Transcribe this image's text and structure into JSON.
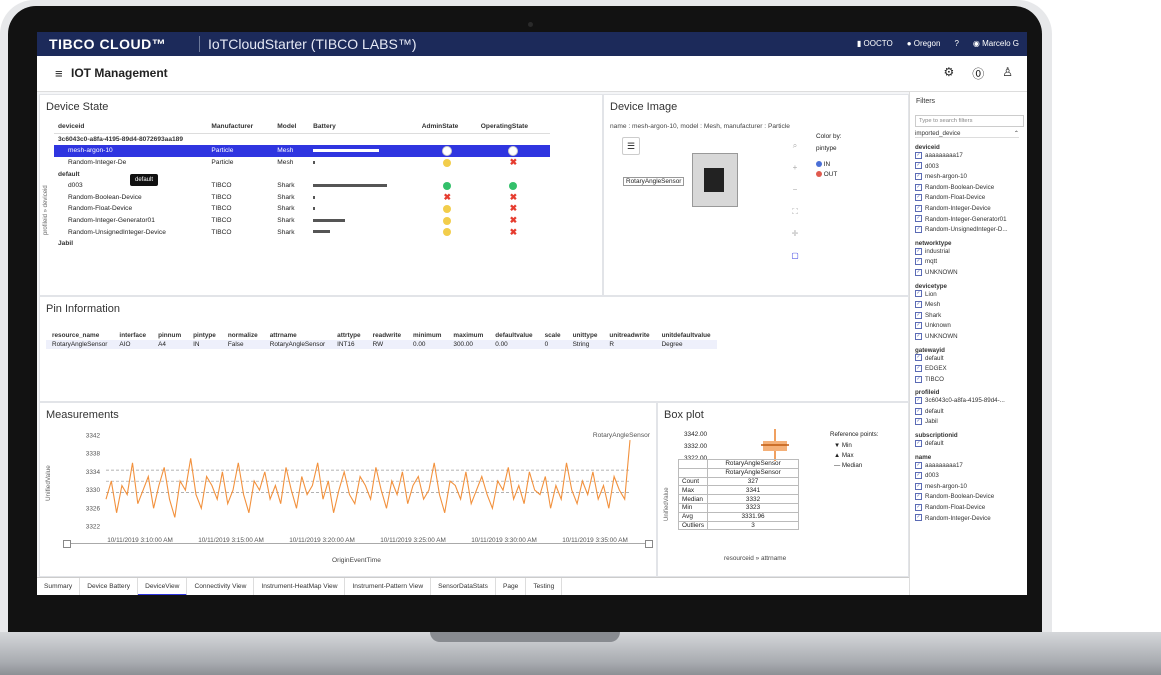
{
  "topbar": {
    "brand": "TIBCO CLOUD™",
    "app": "IoTCloudStarter (TIBCO LABS™)",
    "org": "OOCTO",
    "region": "Oregon",
    "help": "?",
    "user": "Marcelo G"
  },
  "header": {
    "title": "IOT Management"
  },
  "device_state": {
    "title": "Device State",
    "side_label": "profileid » deviceid",
    "columns": [
      "deviceid",
      "Manufacturer",
      "Model",
      "Battery",
      "AdminState",
      "OperatingState"
    ],
    "tooltip": "default",
    "rows": [
      {
        "kind": "group",
        "deviceid": "3c6043c0-a8fa-4195-89d4-8072693aa189"
      },
      {
        "kind": "row",
        "selected": true,
        "deviceid": "mesh-argon-10",
        "manufacturer": "Particle",
        "model": "Mesh",
        "battery": 0.55,
        "admin": "white",
        "oper": "white"
      },
      {
        "kind": "row",
        "deviceid": "Random-Integer-De",
        "manufacturer": "Particle",
        "model": "Mesh",
        "battery": 0.01,
        "admin": "yellow",
        "oper": "x"
      },
      {
        "kind": "group",
        "deviceid": "default"
      },
      {
        "kind": "row",
        "deviceid": "d003",
        "manufacturer": "TIBCO",
        "model": "Shark",
        "battery": 0.62,
        "admin": "green",
        "oper": "green"
      },
      {
        "kind": "row",
        "deviceid": "Random-Boolean-Device",
        "manufacturer": "TIBCO",
        "model": "Shark",
        "battery": 0.01,
        "admin": "x",
        "oper": "x"
      },
      {
        "kind": "row",
        "deviceid": "Random-Float-Device",
        "manufacturer": "TIBCO",
        "model": "Shark",
        "battery": 0.01,
        "admin": "yellow",
        "oper": "x"
      },
      {
        "kind": "row",
        "deviceid": "Random-Integer-Generator01",
        "manufacturer": "TIBCO",
        "model": "Shark",
        "battery": 0.27,
        "admin": "yellow",
        "oper": "x"
      },
      {
        "kind": "row",
        "deviceid": "Random-UnsignedInteger-Device",
        "manufacturer": "TIBCO",
        "model": "Shark",
        "battery": 0.14,
        "admin": "yellow",
        "oper": "x"
      },
      {
        "kind": "group",
        "deviceid": "Jabil"
      }
    ]
  },
  "device_image": {
    "title": "Device Image",
    "subtitle": "name : mesh-argon-10, model : Mesh, manufacturer : Particle",
    "color_by_label": "Color by:",
    "color_by_value": "pintype",
    "legend": [
      {
        "label": "IN",
        "color": "#4a6fd6"
      },
      {
        "label": "OUT",
        "color": "#e05a4e"
      }
    ],
    "sensor_tag": "RotaryAngleSensor"
  },
  "pin_information": {
    "title": "Pin Information",
    "columns": [
      "resource_name",
      "interface",
      "pinnum",
      "pintype",
      "normalize",
      "attrname",
      "attrtype",
      "readwrite",
      "minimum",
      "maximum",
      "defaultvalue",
      "scale",
      "unittype",
      "unitreadwrite",
      "unitdefaultvalue"
    ],
    "rows": [
      [
        "RotaryAngleSensor",
        "AIO",
        "A4",
        "IN",
        "False",
        "RotaryAngleSensor",
        "INT16",
        "RW",
        "0.00",
        "300.00",
        "0.00",
        "0",
        "String",
        "R",
        "Degree"
      ]
    ]
  },
  "measurements": {
    "title": "Measurements",
    "ylabel": "UnifiedValue",
    "xlabel": "OriginEventTime",
    "series_label": "RotaryAngleSensor",
    "yticks": [
      "3342",
      "3338",
      "3334",
      "3330",
      "3326",
      "3322"
    ],
    "xticks": [
      "10/11/2019 3:10:00 AM",
      "10/11/2019 3:15:00 AM",
      "10/11/2019 3:20:00 AM",
      "10/11/2019 3:25:00 AM",
      "10/11/2019 3:30:00 AM",
      "10/11/2019 3:35:00 AM"
    ]
  },
  "chart_data": {
    "type": "line",
    "title": "Measurements",
    "xlabel": "OriginEventTime",
    "ylabel": "UnifiedValue",
    "ylim": [
      3321,
      3343
    ],
    "series": [
      {
        "name": "RotaryAngleSensor",
        "values": [
          3328,
          3332,
          3325,
          3331,
          3329,
          3336,
          3327,
          3330,
          3333,
          3326,
          3331,
          3335,
          3328,
          3324,
          3332,
          3330,
          3337,
          3329,
          3326,
          3333,
          3331,
          3328,
          3334,
          3327,
          3330,
          3336,
          3329,
          3325,
          3332,
          3330,
          3334,
          3328,
          3331,
          3327,
          3335,
          3330,
          3326,
          3333,
          3329,
          3331,
          3336,
          3328,
          3332,
          3325,
          3330,
          3334,
          3329,
          3327,
          3333,
          3331,
          3328,
          3335,
          3330,
          3326,
          3332,
          3329,
          3334,
          3327,
          3331,
          3333,
          3328,
          3330,
          3336,
          3329,
          3325,
          3332,
          3331,
          3328,
          3334,
          3327,
          3330,
          3333,
          3329,
          3326,
          3332,
          3330,
          3335,
          3328,
          3331,
          3327,
          3334,
          3330,
          3329,
          3333,
          3326,
          3331,
          3328,
          3336,
          3330,
          3327,
          3332,
          3329,
          3334,
          3328,
          3331,
          3326,
          3333,
          3330,
          3328,
          3341
        ]
      }
    ],
    "reference_lines": [
      3331.96,
      3329.5,
      3334.4
    ]
  },
  "box_plot": {
    "title": "Box plot",
    "ylabel": "UnifiedValue",
    "xlabel": "resourceid » attrname",
    "yticks": [
      "3342.00",
      "3332.00",
      "3322.00"
    ],
    "reference_title": "Reference points:",
    "reference": [
      {
        "symbol": "▼",
        "label": "Min"
      },
      {
        "symbol": "▲",
        "label": "Max"
      },
      {
        "symbol": "—",
        "label": "Median"
      }
    ],
    "header": [
      "RotaryAngleSensor",
      "RotaryAngleSensor"
    ],
    "stats": [
      [
        "Count",
        "327"
      ],
      [
        "Max",
        "3341"
      ],
      [
        "Median",
        "3332"
      ],
      [
        "Min",
        "3323"
      ],
      [
        "Avg",
        "3331.96"
      ],
      [
        "Outliers",
        "3"
      ]
    ]
  },
  "filters": {
    "title": "Filters",
    "search_placeholder": "Type to search filters",
    "table_name": "imported_device",
    "groups": [
      {
        "name": "deviceid",
        "items": [
          "aaaaaaaaa17",
          "d003",
          "mesh-argon-10",
          "Random-Boolean-Device",
          "Random-Float-Device",
          "Random-Integer-Device",
          "Random-Integer-Generator01",
          "Random-UnsignedInteger-D..."
        ]
      },
      {
        "name": "networktype",
        "items": [
          "industrial",
          "mqtt",
          "UNKNOWN"
        ]
      },
      {
        "name": "devicetype",
        "items": [
          "Lion",
          "Mesh",
          "Shark",
          "Unknown",
          "UNKNOWN"
        ]
      },
      {
        "name": "gatewayid",
        "items": [
          "default",
          "EDGEX",
          "TIBCO"
        ]
      },
      {
        "name": "profileid",
        "items": [
          "3c6043c0-a8fa-4195-89d4-...",
          "default",
          "Jabil"
        ]
      },
      {
        "name": "subscriptionid",
        "items": [
          "default"
        ]
      },
      {
        "name": "name",
        "items": [
          "aaaaaaaaa17",
          "d003",
          "mesh-argon-10",
          "Random-Boolean-Device",
          "Random-Float-Device",
          "Random-Integer-Device"
        ]
      }
    ]
  },
  "tabs": {
    "items": [
      "Summary",
      "Device Battery",
      "DeviceView",
      "Connectivity View",
      "Instrument-HeatMap View",
      "Instrument-Pattern View",
      "SensorDataStats",
      "Page",
      "Testing"
    ],
    "active": "DeviceView"
  }
}
